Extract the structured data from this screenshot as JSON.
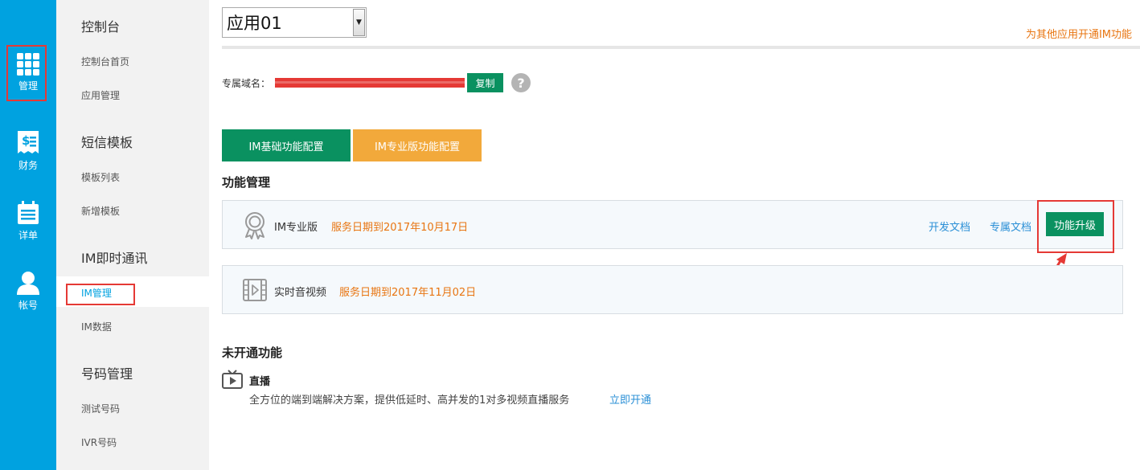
{
  "rail": [
    {
      "label": "管理",
      "icon": "grid-icon"
    },
    {
      "label": "财务",
      "icon": "receipt-icon"
    },
    {
      "label": "详单",
      "icon": "calendar-list-icon"
    },
    {
      "label": "帐号",
      "icon": "user-icon"
    }
  ],
  "submenu": {
    "groups": [
      {
        "title": "控制台",
        "items": [
          "控制台首页",
          "应用管理"
        ]
      },
      {
        "title": "短信模板",
        "items": [
          "模板列表",
          "新增模板"
        ]
      },
      {
        "title": "IM即时通讯",
        "items": [
          "IM管理",
          "IM数据"
        ]
      },
      {
        "title": "号码管理",
        "items": [
          "测试号码",
          "IVR号码"
        ]
      }
    ],
    "active_item": "IM管理"
  },
  "app_select": {
    "value": "应用01"
  },
  "top_link": "为其他应用开通IM功能",
  "domain": {
    "label": "专属域名：",
    "copy_label": "复制",
    "help": "?"
  },
  "tabs": {
    "basic": "IM基础功能配置",
    "pro": "IM专业版功能配置"
  },
  "sections": {
    "managed": "功能管理",
    "not_opened": "未开通功能"
  },
  "features": [
    {
      "name": "IM专业版",
      "date": "服务日期到2017年10月17日",
      "links": [
        "开发文档",
        "专属文档"
      ],
      "button": "功能升级",
      "icon": "award-ribbon-icon"
    },
    {
      "name": "实时音视频",
      "date": "服务日期到2017年11月02日",
      "icon": "video-film-icon"
    }
  ],
  "live": {
    "title": "直播",
    "desc": "全方位的端到端解决方案，提供低延时、高并发的1对多视频直播服务",
    "link": "立即开通",
    "icon": "tv-play-icon"
  },
  "colors": {
    "rail": "#00a2e0",
    "primary_green": "#0a9160",
    "pro_orange": "#f2a93b",
    "date_orange": "#e87511",
    "link_blue": "#2a8fd6",
    "highlight_red": "#e53935"
  }
}
